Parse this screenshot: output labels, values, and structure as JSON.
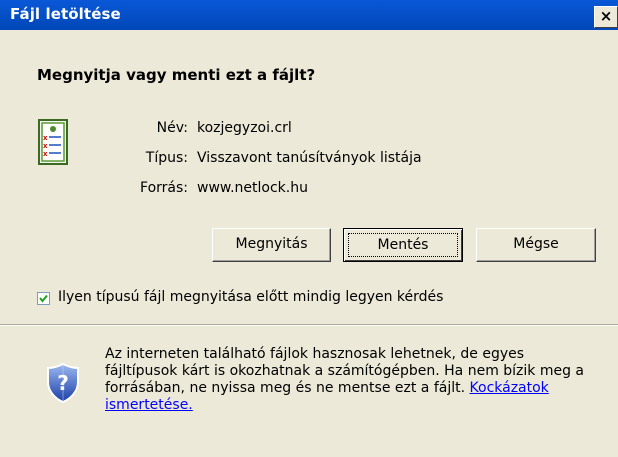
{
  "window": {
    "title": "Fájl letöltése",
    "close_label": "×"
  },
  "dialog": {
    "question": "Megnyitja vagy menti ezt a fájlt?",
    "file_icon": "certificate-revocation-list-icon",
    "fields": [
      {
        "label": "Név:",
        "value": "kozjegyzoi.crl"
      },
      {
        "label": "Típus:",
        "value": "Visszavont tanúsítványok listája"
      },
      {
        "label": "Forrás:",
        "value": "www.netlock.hu"
      }
    ],
    "buttons": {
      "open": "Megnyitás",
      "save": "Mentés",
      "cancel": "Mégse"
    },
    "checkbox": {
      "label": "Ilyen típusú fájl megnyitása előtt mindig legyen kérdés",
      "checked": true
    },
    "info": {
      "icon": "security-shield-question-icon",
      "text": "Az interneten található fájlok hasznosak lehetnek, de egyes fájltípusok kárt is okozhatnak a számítógépben. Ha nem bízik meg a forrásában, ne nyissa meg és ne mentse ezt a fájlt. ",
      "link_text": "Kockázatok ismertetése."
    }
  },
  "colors": {
    "titlebar": "#0054e3",
    "dialog_bg": "#ece9d8",
    "link": "#0000ff"
  }
}
